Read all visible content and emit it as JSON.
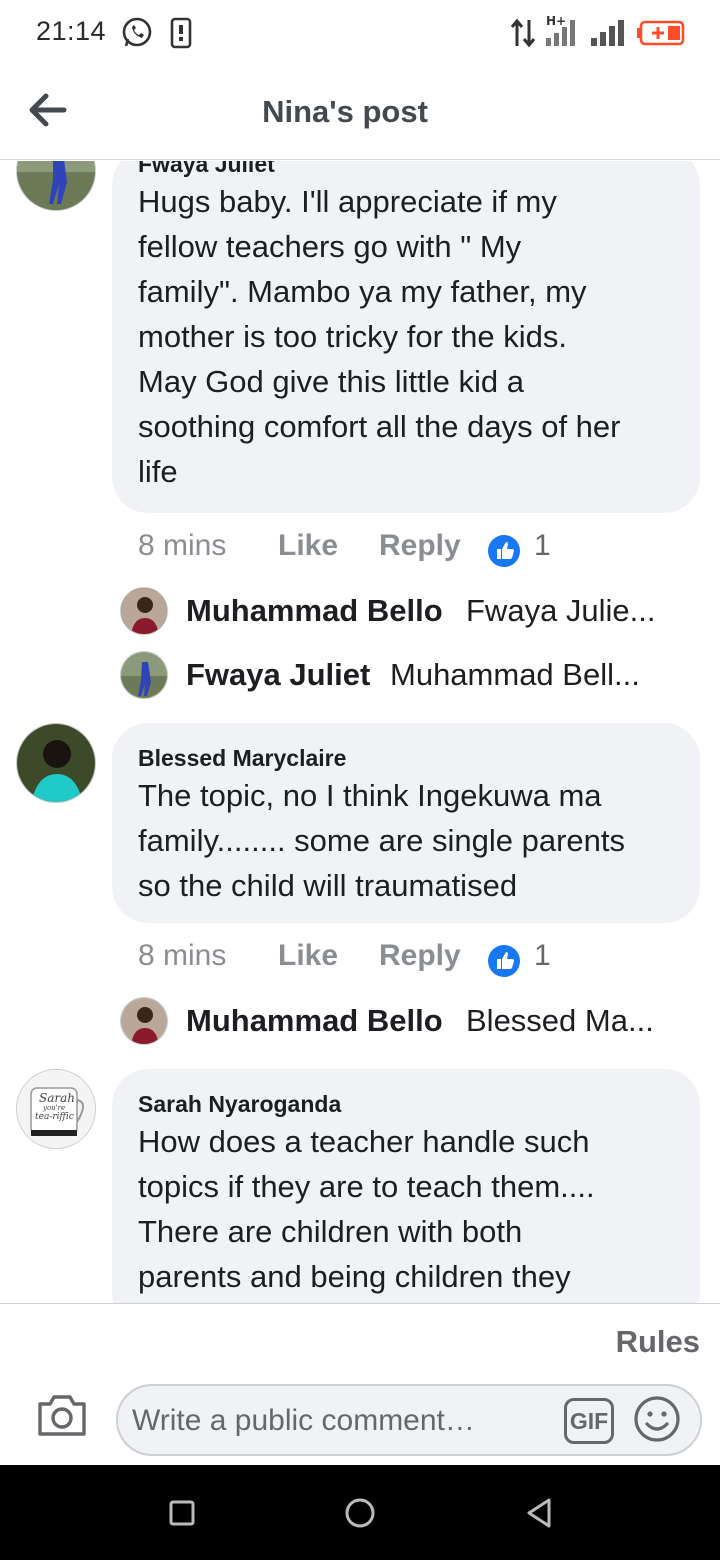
{
  "status_bar": {
    "time": "21:14",
    "icons": [
      "whatsapp-icon",
      "sim-card-icon",
      "data-transfer-icon",
      "hplus-signal-icon",
      "signal-icon",
      "battery-charging-icon"
    ],
    "battery_color": "#ff4d29"
  },
  "header": {
    "title": "Nina's post",
    "back_icon": "arrow-left-icon"
  },
  "comments": [
    {
      "author": "Fwaya Juliet",
      "text_lines": [
        "Hugs baby. I'll appreciate if my",
        "fellow teachers go with \" My",
        "family\". Mambo ya my father, my",
        "mother is too tricky for the kids.",
        "May God give this little kid a",
        "soothing comfort all the days of her",
        "life"
      ],
      "time": "8 mins",
      "like_label": "Like",
      "reply_label": "Reply",
      "reactions": "1",
      "replies": [
        {
          "name": "Muhammad Bello",
          "preview": "Fwaya Julie..."
        },
        {
          "name": "Fwaya Juliet",
          "preview": "Muhammad Bell..."
        }
      ]
    },
    {
      "author": "Blessed Maryclaire",
      "text_lines": [
        "The topic, no I think Ingekuwa ma",
        "family........ some are single parents",
        "so the child will traumatised"
      ],
      "time": "8 mins",
      "like_label": "Like",
      "reply_label": "Reply",
      "reactions": "1",
      "replies": [
        {
          "name": "Muhammad Bello",
          "preview": "Blessed Ma..."
        }
      ]
    },
    {
      "author": "Sarah Nyaroganda",
      "avatar_mug_text": [
        "Sarah",
        "you're",
        "tea-riffic"
      ],
      "text_lines": [
        "How does a teacher handle such",
        "topics if they are to teach them....",
        "There are children with both",
        "parents and being children they"
      ]
    }
  ],
  "composer": {
    "rules_label": "Rules",
    "placeholder": "Write a public comment…",
    "gif_label": "GIF",
    "camera_icon": "camera-icon",
    "emoji_icon": "smiley-icon"
  },
  "navbar": {
    "buttons": [
      "recents-square-icon",
      "home-circle-icon",
      "back-triangle-icon"
    ]
  },
  "colors": {
    "bubble_bg": "#f0f2f5",
    "like_blue": "#1877f2",
    "meta_gray": "#8a8d91"
  }
}
